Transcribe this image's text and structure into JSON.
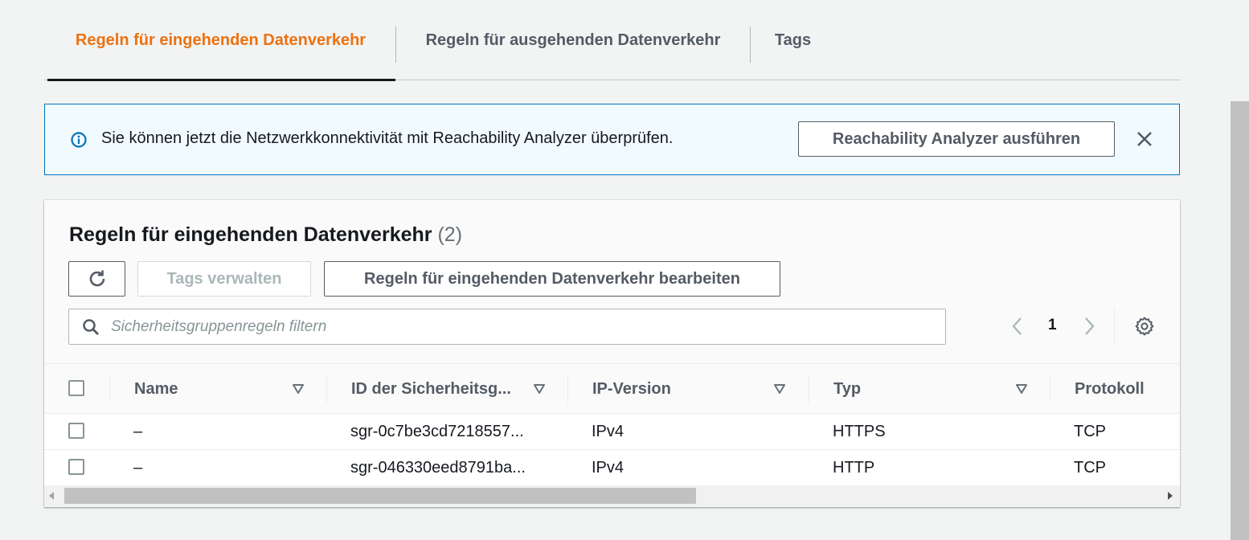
{
  "tabs": [
    {
      "label": "Regeln für eingehenden Datenverkehr",
      "active": true
    },
    {
      "label": "Regeln für ausgehenden Datenverkehr",
      "active": false
    },
    {
      "label": "Tags",
      "active": false
    }
  ],
  "flash": {
    "message": "Sie können jetzt die Netzwerkkonnektivität mit Reachability Analyzer überprüfen.",
    "action_label": "Reachability Analyzer ausführen",
    "icon": "info-icon"
  },
  "panel": {
    "title": "Regeln für eingehenden Datenverkehr",
    "count": "(2)",
    "buttons": {
      "refresh_icon": "refresh-icon",
      "manage_tags": "Tags verwalten",
      "edit_rules": "Regeln für eingehenden Datenverkehr bearbeiten"
    },
    "search": {
      "placeholder": "Sicherheitsgruppenregeln filtern",
      "value": ""
    },
    "pagination": {
      "current_page": "1"
    }
  },
  "table": {
    "columns": [
      "Name",
      "ID der Sicherheitsg...",
      "IP-Version",
      "Typ",
      "Protokoll"
    ],
    "rows": [
      {
        "name": "–",
        "id": "sgr-0c7be3cd7218557...",
        "ip_version": "IPv4",
        "type": "HTTPS",
        "protocol": "TCP"
      },
      {
        "name": "–",
        "id": "sgr-046330eed8791ba...",
        "ip_version": "IPv4",
        "type": "HTTP",
        "protocol": "TCP"
      }
    ]
  },
  "colors": {
    "accent": "#ec7211",
    "info_border": "#0073bb",
    "info_bg": "#f1faff",
    "text": "#16191f",
    "secondary_text": "#545b64"
  }
}
